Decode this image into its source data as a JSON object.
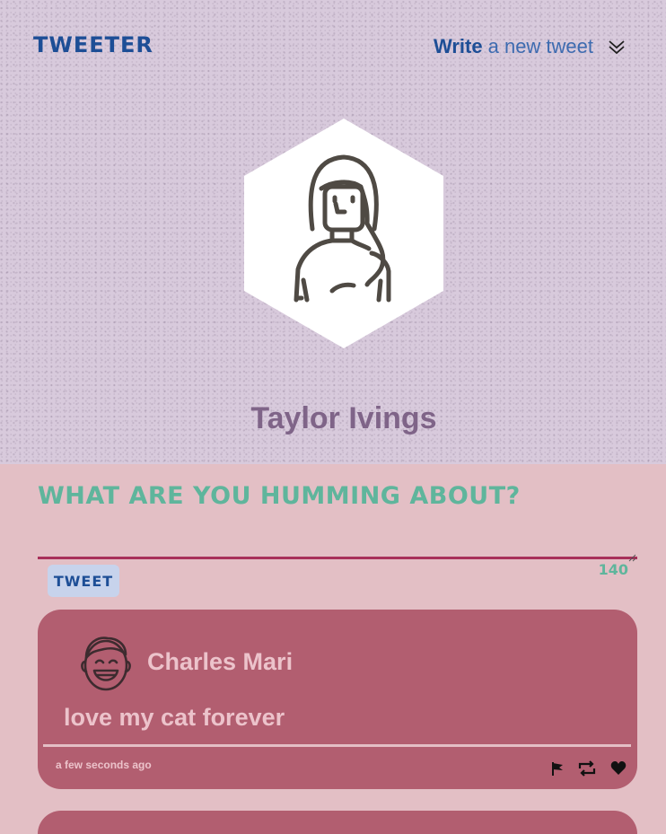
{
  "nav": {
    "brand": "TWEETER",
    "compose_strong": "Write",
    "compose_rest": "a new tweet"
  },
  "profile": {
    "name": "Taylor Ivings"
  },
  "composer": {
    "prompt": "What are you humming about?",
    "button_label": "TWEET",
    "counter": "140"
  },
  "tweets": [
    {
      "author": "Charles Mari",
      "body": "love my cat forever",
      "time": "a few seconds ago"
    }
  ],
  "colors": {
    "header_bg": "#d8cadc",
    "page_bg": "#e3bfc5",
    "brand": "#1d4e96",
    "accent_green": "#5fb59c",
    "tweet_bg": "#b25e70",
    "name_purple": "#7f6488"
  },
  "icons": {
    "compose_toggle": "double-chevron-down-icon",
    "actions": [
      "flag-icon",
      "retweet-icon",
      "heart-icon"
    ]
  }
}
